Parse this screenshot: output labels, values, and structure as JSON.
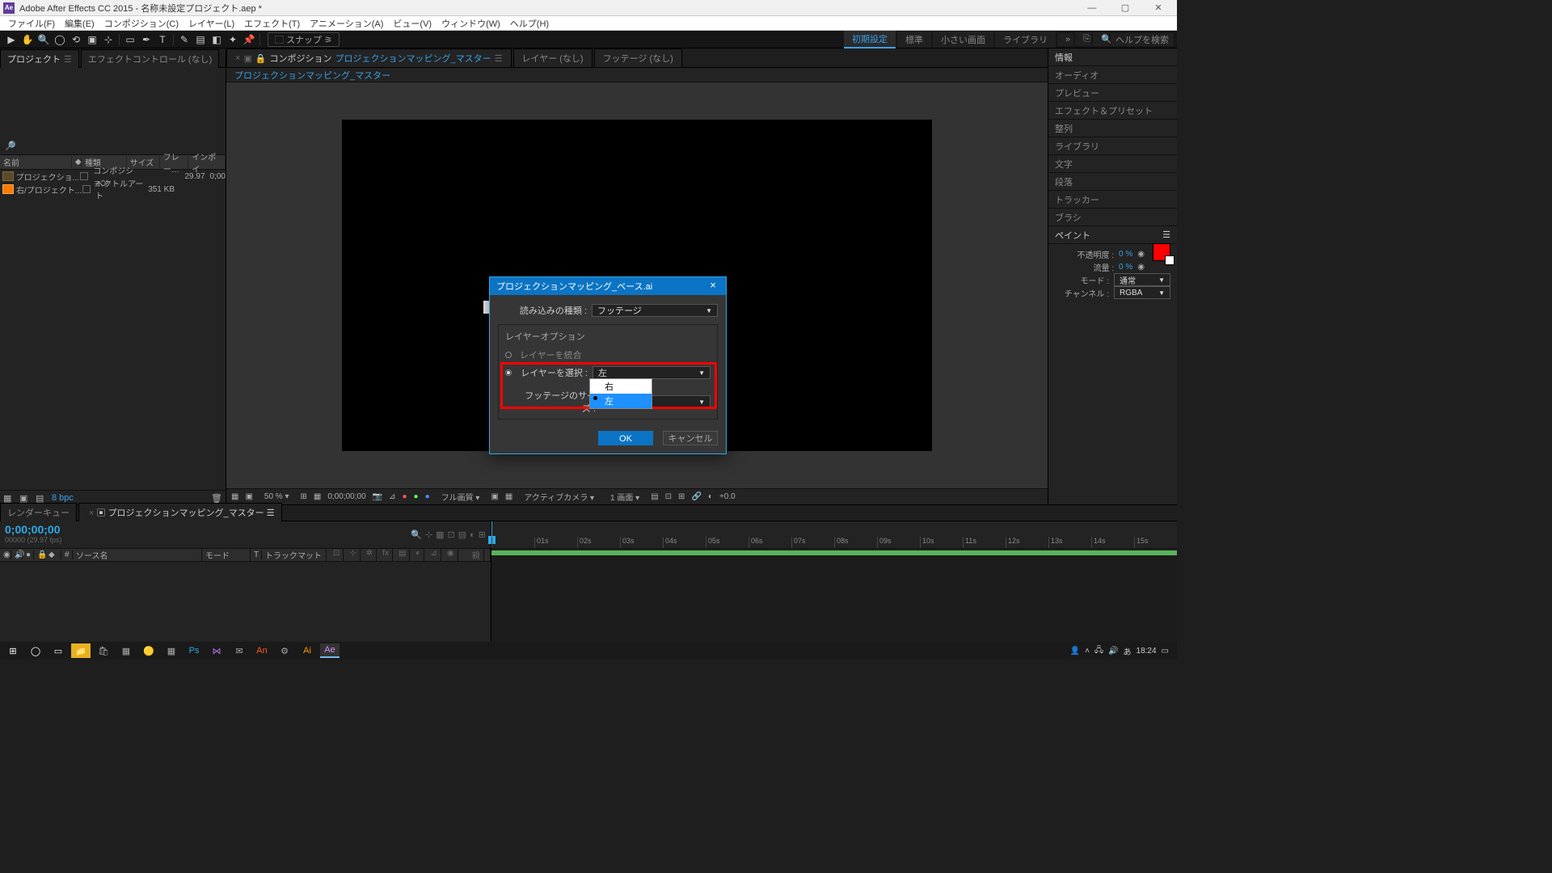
{
  "titlebar": {
    "app": "Adobe After Effects CC 2015 - 名称未設定プロジェクト.aep *"
  },
  "menu": [
    "ファイル(F)",
    "編集(E)",
    "コンポジション(C)",
    "レイヤー(L)",
    "エフェクト(T)",
    "アニメーション(A)",
    "ビュー(V)",
    "ウィンドウ(W)",
    "ヘルプ(H)"
  ],
  "toolbar": {
    "snap": "スナップ"
  },
  "workspaces": {
    "items": [
      "初期設定",
      "標準",
      "小さい画面",
      "ライブラリ"
    ],
    "active": 0,
    "search_placeholder": "ヘルプを検索"
  },
  "left_tabs": {
    "project": "プロジェクト",
    "effect_controls": "エフェクトコントロール (なし)"
  },
  "project": {
    "columns": {
      "name": "名前",
      "type": "種類",
      "size": "サイズ",
      "fps": "フレー…",
      "in": "インポイ"
    },
    "rows": [
      {
        "name": "プロジェクショ...",
        "type": "コンポジション",
        "size": "",
        "fps": "29.97",
        "extra": "0;00"
      },
      {
        "name": "右/プロジェクト...",
        "type": "ベクトルアート",
        "size": "351 KB",
        "fps": "",
        "extra": ""
      }
    ],
    "bpc": "8 bpc"
  },
  "center_tabs": {
    "comp_prefix": "コンポジション",
    "comp_name": "プロジェクションマッピング_マスター",
    "layer": "レイヤー (なし)",
    "footage": "フッテージ (なし)",
    "breadcrumb": "プロジェクションマッピング_マスター"
  },
  "viewer_footer": {
    "zoom": "50 %",
    "timecode": "0;00;00;00",
    "full": "フル画質",
    "camera": "アクティブカメラ",
    "views": "1 画面",
    "exposure": "+0.0"
  },
  "right_panels": [
    "情報",
    "オーディオ",
    "プレビュー",
    "エフェクト＆プリセット",
    "整列",
    "ライブラリ",
    "文字",
    "段落",
    "トラッカー",
    "ブラシ"
  ],
  "paint": {
    "title": "ペイント",
    "opacity_label": "不透明度 :",
    "opacity": "0 %",
    "flow_label": "流量 :",
    "flow": "0 %",
    "mode_label": "モード :",
    "mode": "通常",
    "channel_label": "チャンネル :",
    "channel": "RGBA"
  },
  "timeline": {
    "tabs": {
      "render_queue": "レンダーキュー",
      "comp": "プロジェクションマッピング_マスター"
    },
    "timecode": "0;00;00;00",
    "sub": "00000 (29.97 fps)",
    "columns": {
      "source": "ソース名",
      "mode": "モード",
      "trkmat": "トラックマット"
    },
    "marks": [
      "",
      "01s",
      "02s",
      "03s",
      "04s",
      "05s",
      "06s",
      "07s",
      "08s",
      "09s",
      "10s",
      "11s",
      "12s",
      "13s",
      "14s",
      "15s"
    ]
  },
  "dialog": {
    "title": "プロジェクションマッピング_ベース.ai",
    "import_kind_label": "読み込みの種類 :",
    "import_kind": "フッテージ",
    "layer_options": "レイヤーオプション",
    "merge_layers": "レイヤーを統合",
    "select_layer_label": "レイヤーを選択 :",
    "select_layer_value": "左",
    "footage_size_label": "フッテージのサイズ :",
    "dropdown_options": [
      "右",
      "左"
    ],
    "ok": "OK",
    "cancel": "キャンセル"
  },
  "taskbar": {
    "clock": "18:24"
  }
}
